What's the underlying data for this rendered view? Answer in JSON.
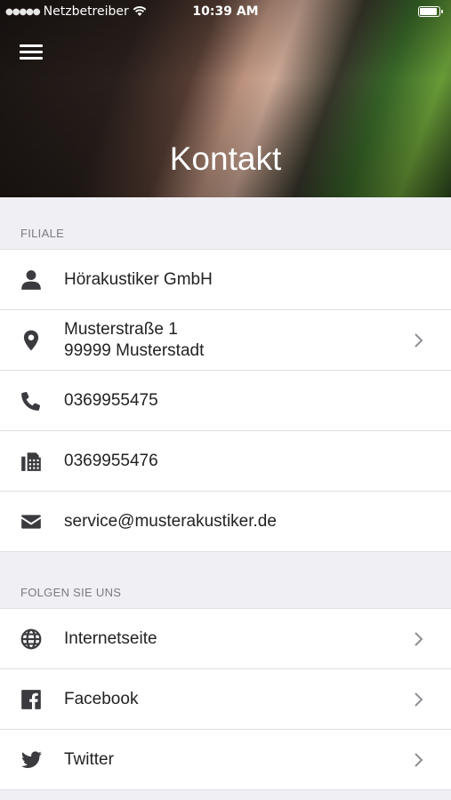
{
  "status_bar": {
    "carrier": "Netzbetreiber",
    "time": "10:39 AM",
    "battery_level": 0.9
  },
  "header": {
    "title": "Kontakt"
  },
  "filiale": {
    "section_label": "FILIALE",
    "company": "Hörakustiker GmbH",
    "street": "Musterstraße 1",
    "city": "99999 Musterstadt",
    "phone": "0369955475",
    "fax": "0369955476",
    "email": "service@musterakustiker.de"
  },
  "follow": {
    "section_label": "FOLGEN SIE UNS",
    "items": [
      {
        "label": "Internetseite",
        "icon": "globe-icon"
      },
      {
        "label": "Facebook",
        "icon": "facebook-icon"
      },
      {
        "label": "Twitter",
        "icon": "twitter-icon"
      }
    ]
  },
  "colors": {
    "background": "#efeff4",
    "icon": "#3b3b3f",
    "chevron": "#8e8e93",
    "section_text": "#7a7a7f"
  }
}
